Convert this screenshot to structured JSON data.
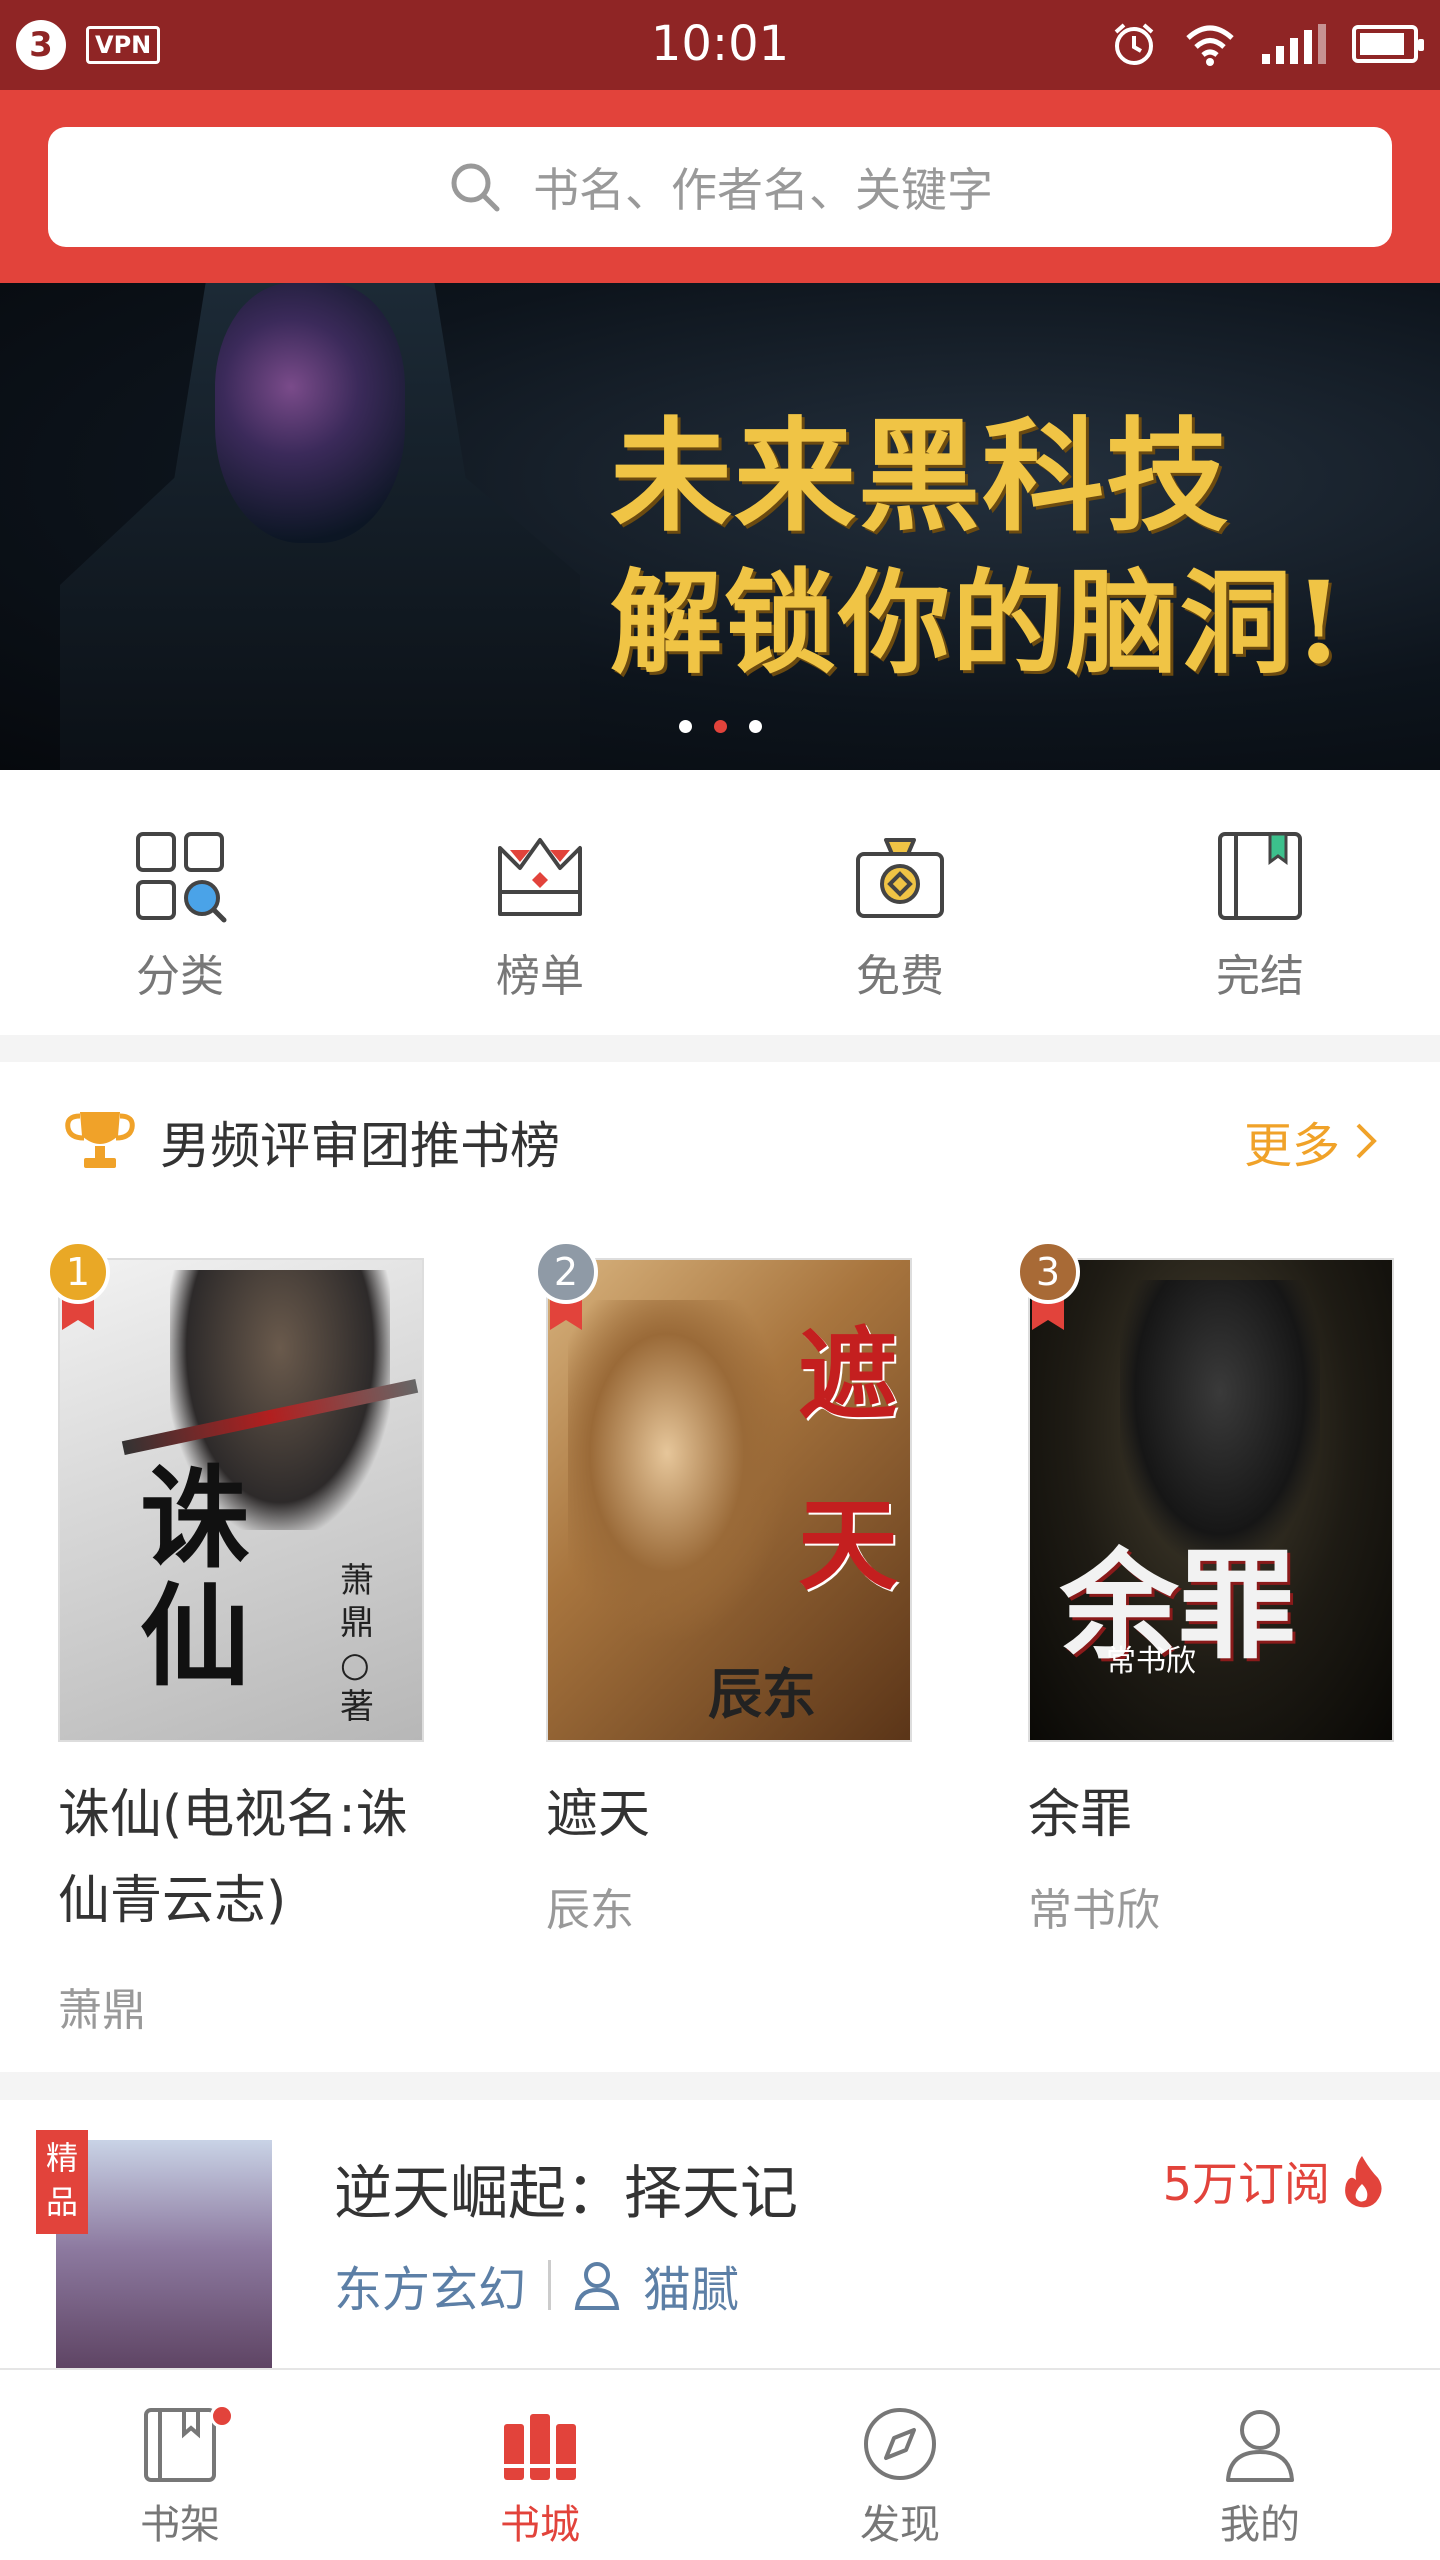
{
  "status_bar": {
    "notification_count": "3",
    "vpn": "VPN",
    "time": "10:01"
  },
  "search": {
    "placeholder": "书名、作者名、关键字"
  },
  "banner": {
    "title_line1": "未来黑科技",
    "title_line2": "解锁你的脑洞!",
    "page_count": 3,
    "active_page": 2
  },
  "quick_nav": [
    {
      "label": "分类",
      "icon": "category-grid-icon"
    },
    {
      "label": "榜单",
      "icon": "crown-icon"
    },
    {
      "label": "免费",
      "icon": "free-coin-bag-icon"
    },
    {
      "label": "完结",
      "icon": "finished-book-icon"
    }
  ],
  "ranking": {
    "title": "男频评审团推书榜",
    "more": "更多",
    "books": [
      {
        "rank": "1",
        "title": "诛仙(电视名:诛仙青云志)",
        "author": "萧鼎",
        "cover_text": "诛仙",
        "cover_author": "萧鼎○著",
        "badge_color": "#e9a826"
      },
      {
        "rank": "2",
        "title": "遮天",
        "author": "辰东",
        "cover_text": "遮天",
        "cover_author": "辰东",
        "badge_color": "#8f9aa6"
      },
      {
        "rank": "3",
        "title": "余罪",
        "author": "常书欣",
        "cover_text": "余罪",
        "cover_author": "常书欣",
        "badge_color": "#a86a36"
      }
    ]
  },
  "featured": {
    "tag": "精品",
    "title": "逆天崛起：择天记",
    "subscriptions": "5万订阅",
    "category": "东方玄幻",
    "author": "猫腻"
  },
  "tab_bar": [
    {
      "label": "书架",
      "icon": "bookshelf-icon",
      "active": false
    },
    {
      "label": "书城",
      "icon": "bookstore-icon",
      "active": true
    },
    {
      "label": "发现",
      "icon": "compass-icon",
      "active": false
    },
    {
      "label": "我的",
      "icon": "user-icon",
      "active": false
    }
  ],
  "colors": {
    "status_bar": "#8f2525",
    "primary": "#e2433b",
    "more_link": "#f0a229",
    "category_text": "#5c7fa6"
  }
}
